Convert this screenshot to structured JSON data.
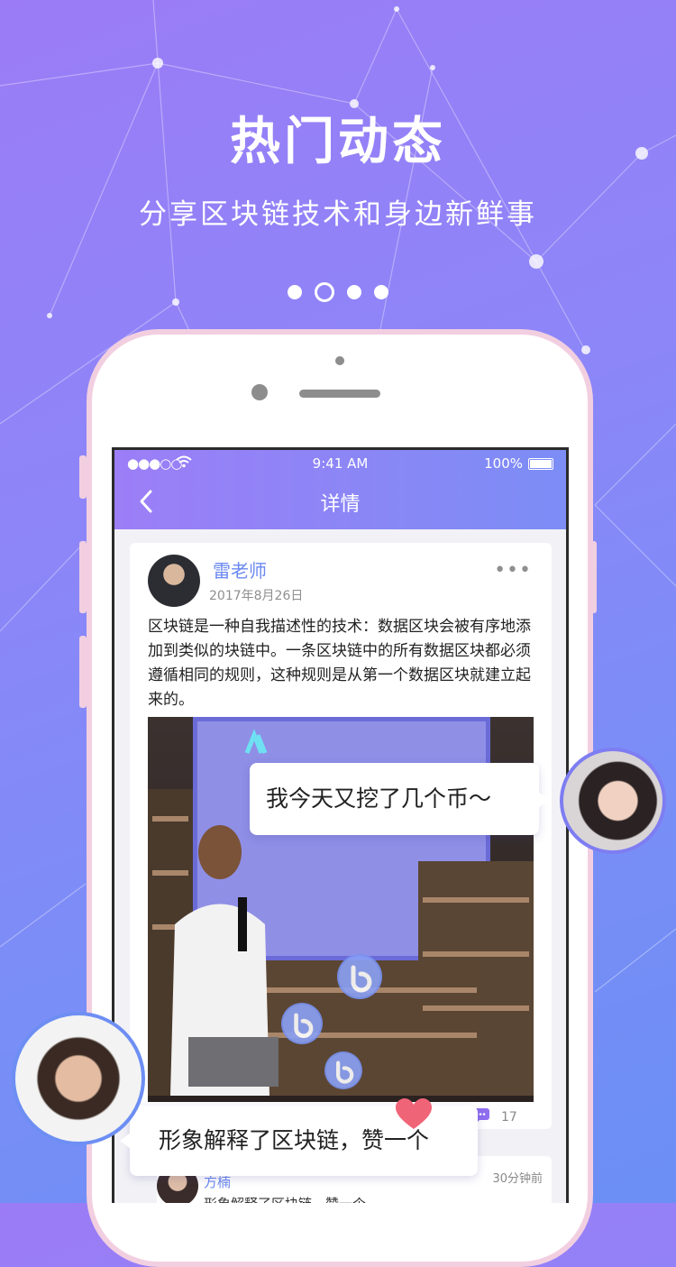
{
  "banner": {
    "title": "热门动态",
    "subtitle": "分享区块链技术和身边新鲜事",
    "page_dots": 4,
    "active_dot": 2
  },
  "status_bar": {
    "signal": "●●●○○",
    "time": "9:41 AM",
    "battery": "100%"
  },
  "nav": {
    "back_icon": "chevron-left-icon",
    "title": "详情"
  },
  "post": {
    "author": "雷老师",
    "date": "2017年8月26日",
    "more_icon": "more-dots-icon",
    "text": "区块链是一种自我描述性的技术：数据区块会被有序地添加到类似的块链中。一条区块链中的所有数据区块都必须遵循相同的规则，这种规则是从第一个数据区块就建立起来的。",
    "comment_count": "17"
  },
  "comment": {
    "name": "方楠",
    "time": "30分钟前",
    "text": "形象解释了区块链，赞一个"
  },
  "bubbles": {
    "top": "我今天又挖了几个币～",
    "bottom": "形象解释了区块链，赞一个"
  },
  "colors": {
    "accent": "#6b88f0",
    "phone_frame": "#f2cfe0",
    "heart": "#f06478"
  }
}
